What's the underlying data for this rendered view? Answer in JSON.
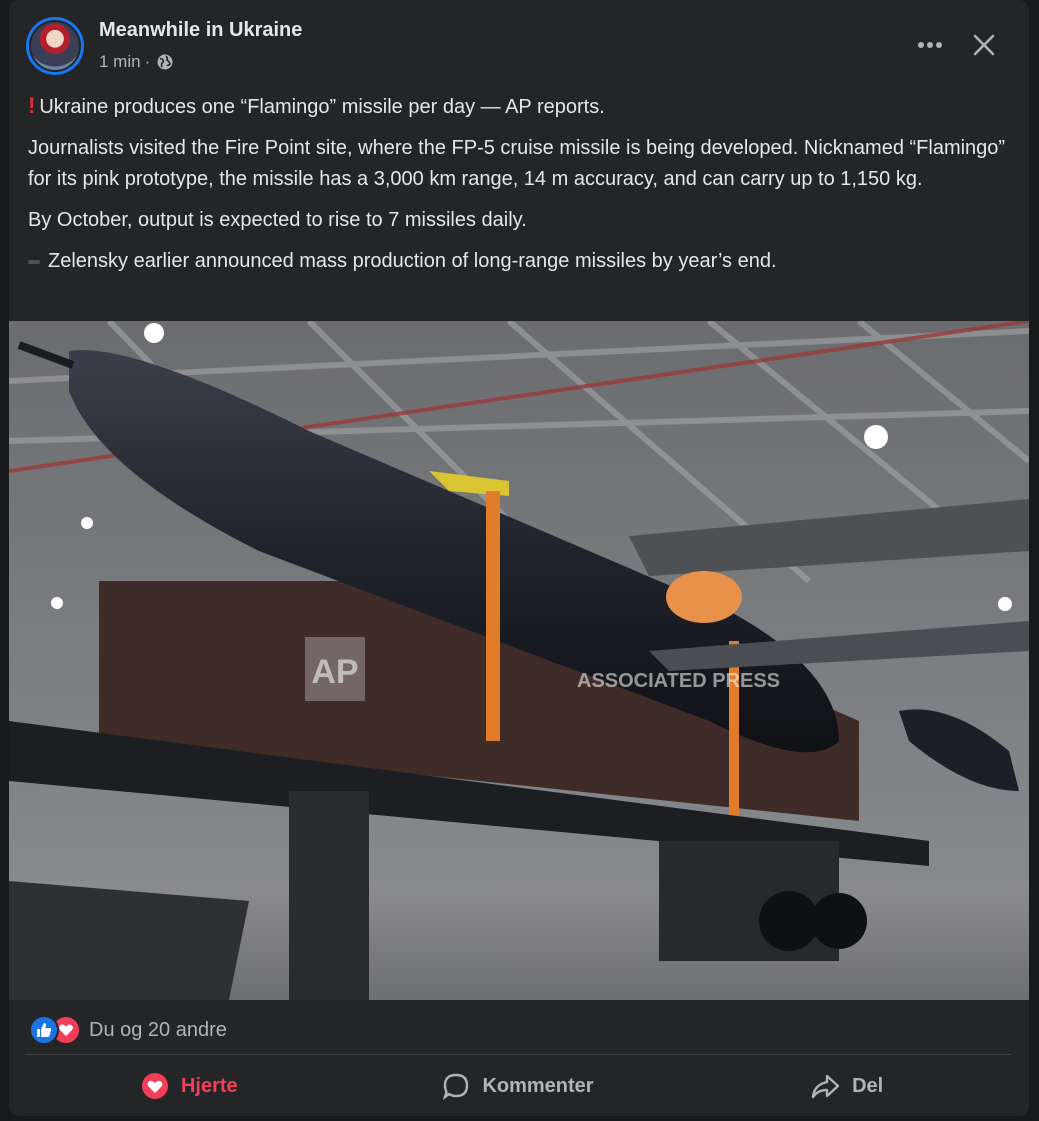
{
  "post": {
    "page_name": "Meanwhile in Ukraine",
    "time": "1 min",
    "separator": "·",
    "audience_icon": "globe-icon"
  },
  "header_icons": {
    "more": "more-dots-icon",
    "close": "close-icon"
  },
  "content": {
    "line1": "Ukraine produces one “Flamingo” missile per day — AP reports.",
    "line1_icon": "exclamation-icon",
    "line2": "Journalists visited the Fire Point site, where the FP-5 cruise missile is being developed. Nicknamed “Flamingo” for its pink prototype, the missile has a 3,000 km range, 14 m accuracy, and can carry up to 1,150 kg.",
    "line3": "By October, output is expected to rise to 7 missiles daily.",
    "line4": "Zelensky earlier announced mass production of long-range missiles by year’s end.",
    "line4_icon": "bullet-icon"
  },
  "image": {
    "watermark_ap": "AP",
    "watermark_text": "ASSOCIATED PRESS"
  },
  "reactions": {
    "icons": [
      "like-icon",
      "love-icon"
    ],
    "summary": "Du og 20 andre"
  },
  "actions": {
    "heart_label": "Hjerte",
    "comment_label": "Kommenter",
    "share_label": "Del"
  },
  "colors": {
    "background": "#18191a",
    "card": "#242526",
    "text": "#e4e6eb",
    "secondary_text": "#b0b3b8",
    "love_red": "#f33e58",
    "like_blue": "#1b74e4"
  }
}
